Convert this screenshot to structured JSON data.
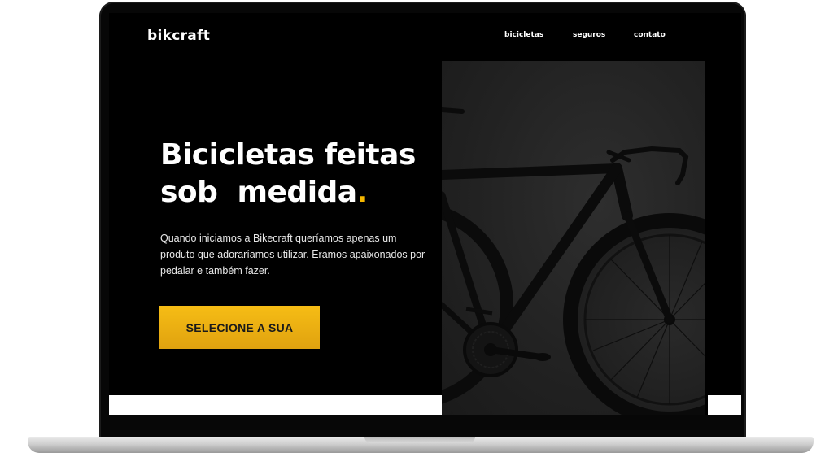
{
  "brand": {
    "logo": "bikcraft"
  },
  "nav": {
    "items": [
      "bicicletas",
      "seguros",
      "contato"
    ]
  },
  "hero": {
    "title_line1": "Bicicletas feitas",
    "title_line2": "sob  medida",
    "title_dot": ".",
    "text": "Quando iniciamos a Bikecraft queríamos apenas um produto que adoraríamos utilizar. Eramos apaixonados por pedalar e também fazer.",
    "cta_label": "SELECIONE A SUA"
  },
  "colors": {
    "accent": "#f5b700",
    "background": "#000000",
    "text": "#ffffff"
  },
  "image": {
    "name": "black-road-bike-photo"
  }
}
